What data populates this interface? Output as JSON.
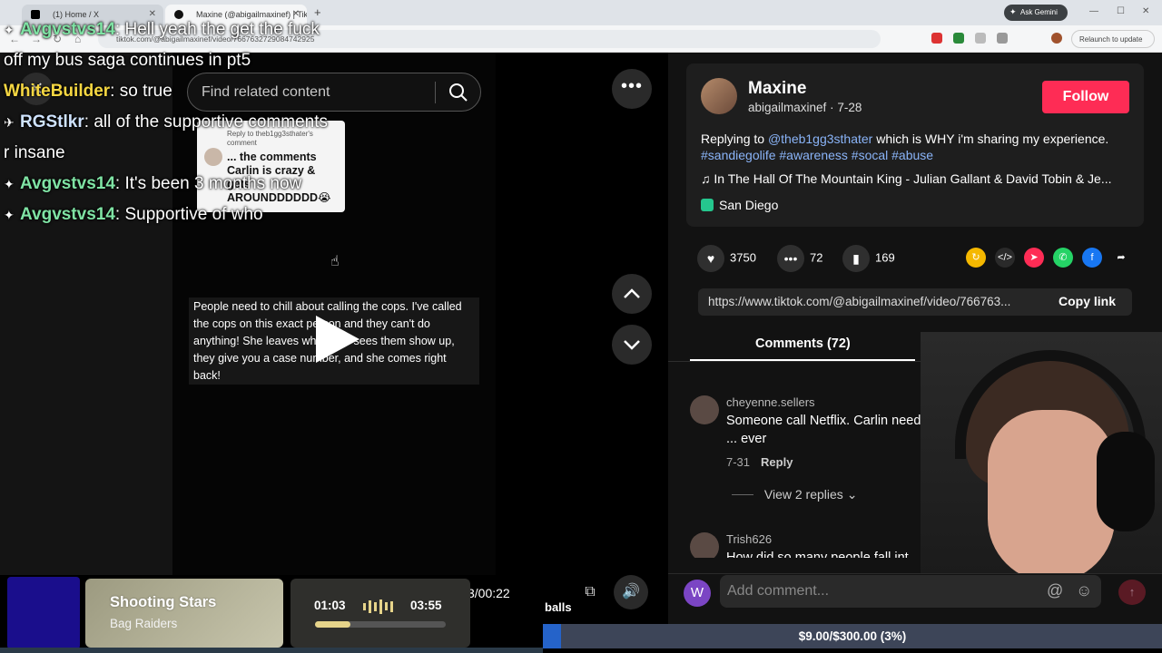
{
  "browser": {
    "tabs": [
      {
        "label": "(1) Home / X"
      },
      {
        "label": "Maxine (@abigailmaxinef) | TikTok"
      }
    ],
    "url": "tiktok.com/@abigailmaxinef/video/7667632729084742925",
    "gemini_label": "Ask Gemini",
    "relaunch_label": "Relaunch to update"
  },
  "search": {
    "placeholder": "Find related content"
  },
  "chat": [
    {
      "user": "Avgvstvs14",
      "badge": "✦",
      "user_color": "#7fe3a4",
      "message": "Hell yeah the get the fuck off my bus saga continues in pt5"
    },
    {
      "user": "WhiteBuilder",
      "badge": "",
      "user_color": "#f5d742",
      "message": "so true"
    },
    {
      "user": "RGStlkr",
      "badge": "✈",
      "user_color": "#cfe3ff",
      "message": "all of the supportive comments r insane"
    },
    {
      "user": "Avgvstvs14",
      "badge": "✦",
      "user_color": "#7fe3a4",
      "message": "It's been 3 months now"
    },
    {
      "user": "Avgvstvs14",
      "badge": "✦",
      "user_color": "#7fe3a4",
      "message": "Supportive of who"
    }
  ],
  "reply_card": {
    "header": "Reply to theb1gg3sthater's comment",
    "body": "... the comments Carlin is crazy & gets AROUNDDDDDD😭"
  },
  "caption": "People need to chill about calling the cops. I've called the cops on this exact person and they can't do anything! She leaves when she sees them show up, they give you a case number, and she comes right back!",
  "post": {
    "name": "Maxine",
    "handle": "abigailmaxinef",
    "date": "7-28",
    "follow_label": "Follow",
    "desc_prefix": "Replying to ",
    "mention": "@theb1gg3sthater",
    "desc_rest": " which is WHY i'm sharing my experience.",
    "hashtags": "#sandiegolife #awareness #socal #abuse",
    "music": "In The Hall Of The Mountain King - Julian Gallant & David Tobin & Je...",
    "location": "San Diego"
  },
  "stats": {
    "likes": "3750",
    "comments": "72",
    "saves": "169"
  },
  "share_icons": [
    {
      "name": "repost-icon",
      "color": "#f5b800",
      "glyph": "↻"
    },
    {
      "name": "embed-icon",
      "color": "#2a2a2a",
      "glyph": "</>"
    },
    {
      "name": "send-icon",
      "color": "#fe2c55",
      "glyph": "➤"
    },
    {
      "name": "whatsapp-icon",
      "color": "#25d366",
      "glyph": "✆"
    },
    {
      "name": "facebook-icon",
      "color": "#1877f2",
      "glyph": "f"
    },
    {
      "name": "forward-icon",
      "color": "transparent",
      "glyph": "➦"
    }
  ],
  "link": {
    "url": "https://www.tiktok.com/@abigailmaxinef/video/766763...",
    "copy_label": "Copy link"
  },
  "comments_tab": "Comments (72)",
  "comments": [
    {
      "user": "cheyenne.sellers",
      "text": "Someone call Netflix. Carlin needs ... ever",
      "date": "7-31",
      "reply_label": "Reply",
      "view_replies": "View 2 replies"
    },
    {
      "user": "Trish626",
      "text": "How did so many people fall int..."
    }
  ],
  "composer": {
    "avatar_letter": "W",
    "placeholder": "Add comment...",
    "at": "@",
    "emoji": "☺"
  },
  "video": {
    "time": "3/00:22"
  },
  "music_widget": {
    "title": "Shooting Stars",
    "artist": "Bag Raiders",
    "current": "01:03",
    "total": "03:55",
    "progress": 0.27
  },
  "goal": {
    "label": "balls",
    "text": "$9.00/$300.00 (3%)",
    "fraction": 0.03
  }
}
